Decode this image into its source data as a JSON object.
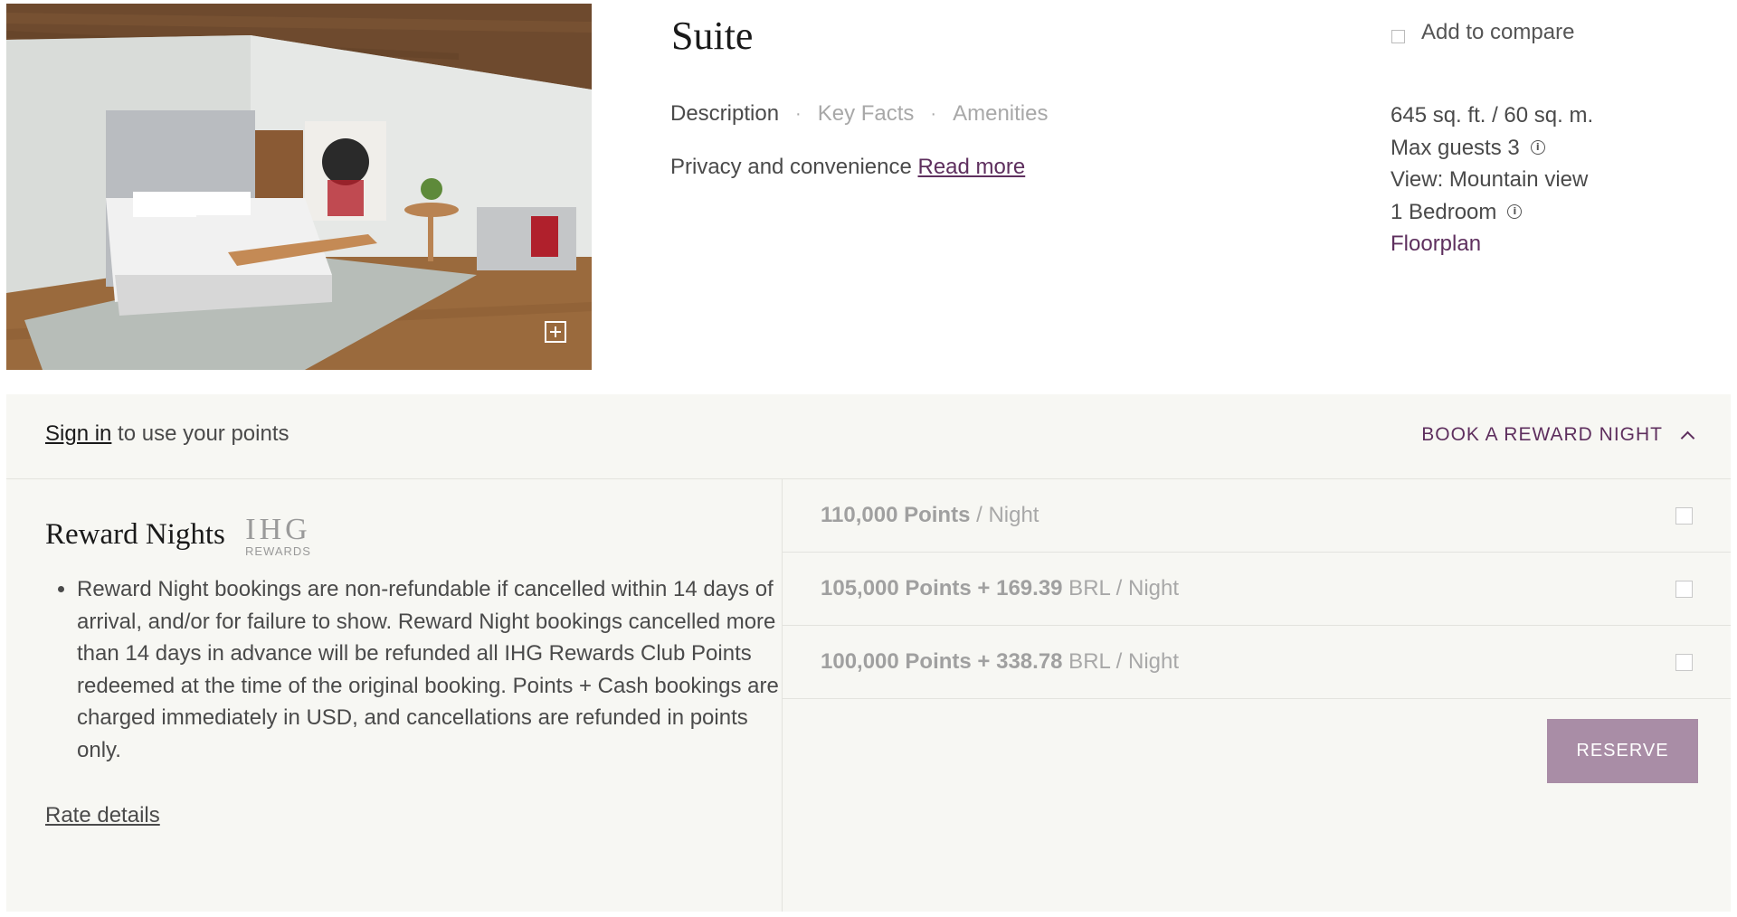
{
  "room": {
    "title": "Suite",
    "tabs": [
      {
        "label": "Description",
        "active": true
      },
      {
        "label": "Key Facts",
        "active": false
      },
      {
        "label": "Amenities",
        "active": false
      }
    ],
    "tagline": "Privacy and convenience",
    "read_more": "Read more",
    "compare_label": "Add to compare",
    "facts": {
      "size": "645 sq. ft. / 60 sq. m.",
      "max_guests": "Max guests 3",
      "view": "View: Mountain view",
      "bedrooms": "1 Bedroom",
      "floorplan": "Floorplan"
    },
    "info_icon": "i",
    "photo_icons": [
      "expand-icon"
    ]
  },
  "reward": {
    "signin_link": "Sign in",
    "signin_text": " to use your points",
    "book_toggle": "BOOK A REWARD NIGHT",
    "title": "Reward Nights",
    "logo_main": "IHG",
    "logo_sub": "REWARDS",
    "policy": "Reward Night bookings are non-refundable if cancelled within 14 days of arrival, and/or for failure to show. Reward Night bookings cancelled more than 14 days in advance will be refunded all IHG Rewards Club Points redeemed at the time of the original booking. Points + Cash bookings are charged immediately in USD, and cancellations are refunded in points only.",
    "rate_details": "Rate details",
    "options": [
      {
        "bold": "110,000 Points",
        "rest": " / Night"
      },
      {
        "bold": "105,000 Points + 169.39",
        "rest": " BRL / Night"
      },
      {
        "bold": "100,000 Points + 338.78",
        "rest": " BRL / Night"
      }
    ],
    "reserve": "RESERVE"
  },
  "colors": {
    "accent": "#5e2f5e",
    "panel_bg": "#f7f7f3",
    "reserve_bg": "#a98da6"
  }
}
